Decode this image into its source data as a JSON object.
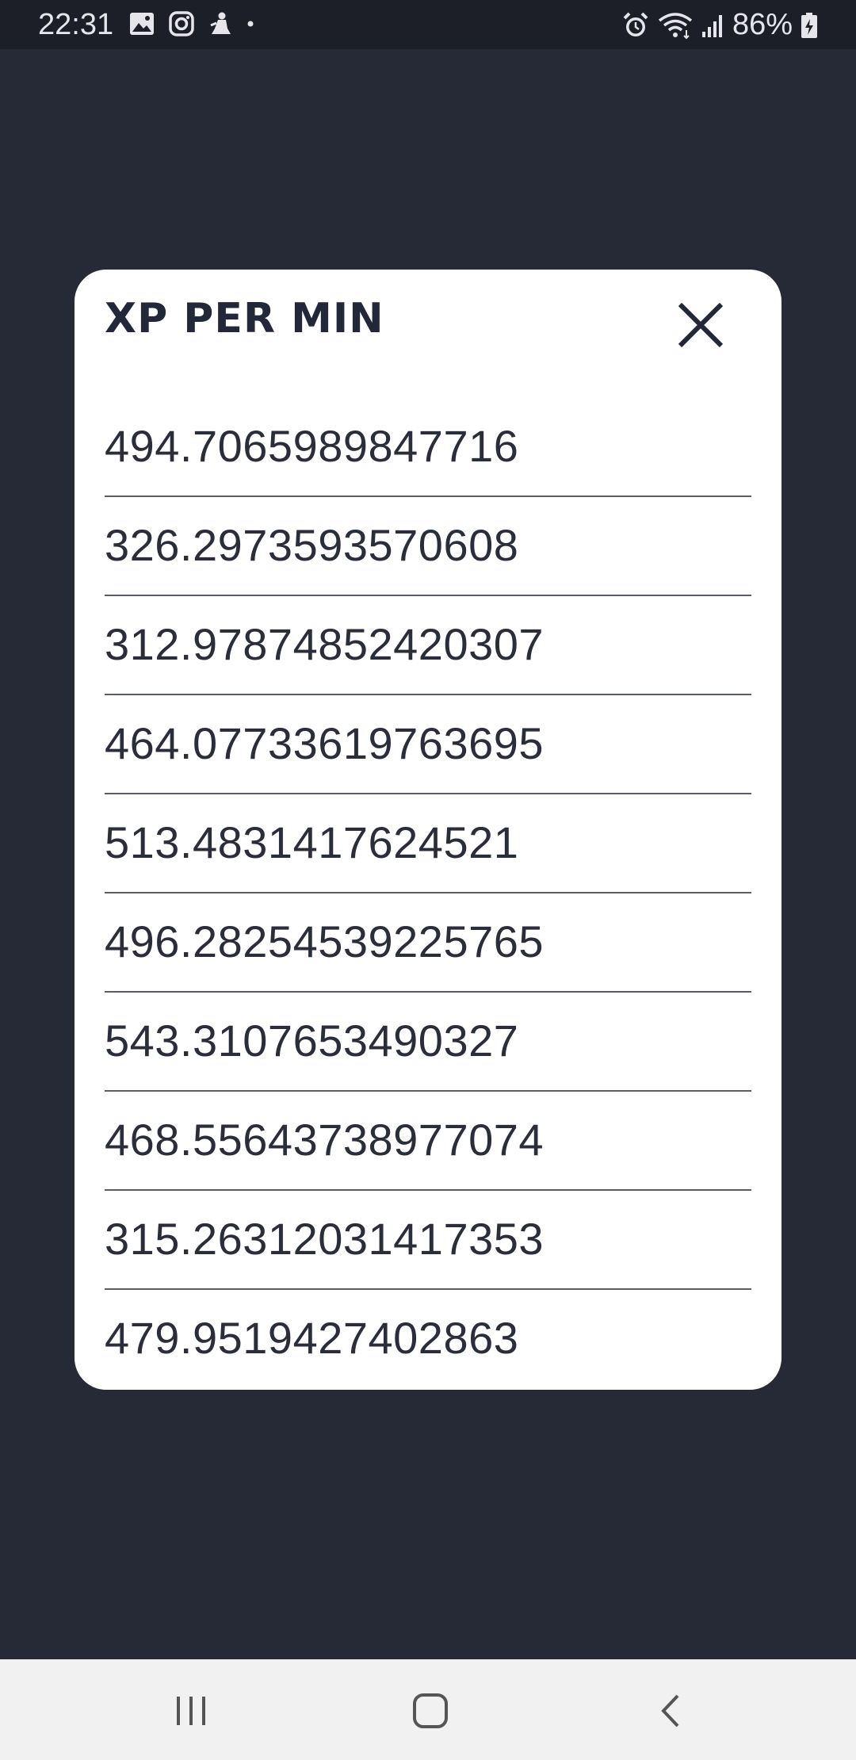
{
  "status_bar": {
    "time": "22:31",
    "battery": "86%",
    "left_icons": [
      "gallery-icon",
      "instagram-icon",
      "app-notification-icon",
      "dot-icon"
    ],
    "right_icons": [
      "alarm-icon",
      "wifi-icon",
      "signal-icon",
      "battery-charging-icon"
    ]
  },
  "dialog": {
    "title": "XP PER MIN",
    "close_icon": "close-icon",
    "items": [
      "494.7065989847716",
      "326.2973593570608",
      "312.97874852420307",
      "464.07733619763695",
      "513.4831417624521",
      "496.28254539225765",
      "543.3107653490327",
      "468.55643738977074",
      "315.26312031417353",
      "479.9519427402863"
    ]
  },
  "nav_bar": {
    "buttons": [
      "recent-apps-icon",
      "home-icon",
      "back-icon"
    ]
  },
  "colors": {
    "background": "#262a36",
    "status_bar": "#1c1f28",
    "dialog": "#ffffff",
    "text": "#2a2d3a",
    "nav_bar": "#f1f1f1"
  }
}
